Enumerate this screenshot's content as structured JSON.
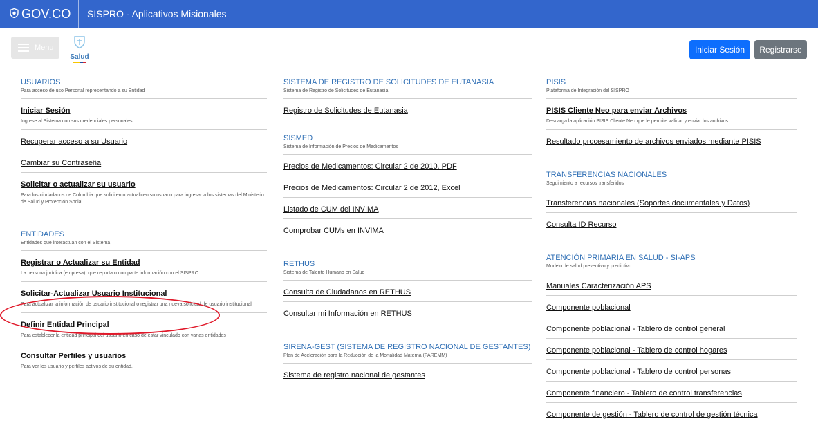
{
  "topbar": {
    "gov_label": "GOV.CO",
    "app_title": "SISPRO - Aplicativos Misionales"
  },
  "header": {
    "menu_label": "Menu",
    "salud_label": "Salud",
    "login_label": "Iniciar Sesión",
    "register_label": "Registrarse"
  },
  "col1": {
    "usuarios": {
      "title": "USUARIOS",
      "subtitle": "Para acceso de uso Personal representando a su Entidad",
      "items": [
        {
          "label": "Iniciar Sesión",
          "desc": "Ingrese al Sistema con sus credenciales personales"
        },
        {
          "label": "Recuperar acceso a su Usuario"
        },
        {
          "label": "Cambiar su Contraseña"
        },
        {
          "label": "Solicitar o actualizar su usuario",
          "desc": "Para los ciudadanos de Colombia que soliciten o actualicen su usuario para ingresar a los sistemas del Ministerio de Salud y Protección Social."
        }
      ]
    },
    "entidades": {
      "title": "ENTIDADES",
      "subtitle": "Entidades que interactuan con el Sistema",
      "items": [
        {
          "label": "Registrar o Actualizar su Entidad",
          "desc": "La persona jurídica (empresa), que reporta o comparte información con el SISPRO"
        },
        {
          "label": "Solicitar-Actualizar Usuario Institucional",
          "desc": "Para actualizar la información de usuario institucional o registrar una nueva solicitud de usuario institucional"
        },
        {
          "label": "Definir Entidad Principal",
          "desc": "Para establecer la entidad principal del usuario en caso de estar vinculado con varias entidades"
        },
        {
          "label": "Consultar Perfiles y usuarios",
          "desc": "Para ver los usuario y perfiles activos de su entidad."
        }
      ]
    }
  },
  "col2": {
    "eutanasia": {
      "title": "SISTEMA DE REGISTRO DE SOLICITUDES DE EUTANASIA",
      "subtitle": "Sistema de Registro de Solicitudes de Eutanasia",
      "items": [
        "Registro de Solicitudes de Eutanasia"
      ]
    },
    "sismed": {
      "title": "SISMED",
      "subtitle": "Sistema de Información de Precios de Medicamentos",
      "items": [
        "Precios de Medicamentos: Circular 2 de 2010, PDF",
        "Precios de Medicamentos: Circular 2 de 2012, Excel",
        "Listado de CUM del INVIMA",
        "Comprobar CUMs en INVIMA"
      ]
    },
    "rethus": {
      "title": "RETHUS",
      "subtitle": "Sistema de Talento Humano en Salud",
      "items": [
        "Consulta de Ciudadanos en RETHUS",
        "Consultar mi Información en RETHUS"
      ]
    },
    "sirena": {
      "title": "SIRENA-GEST (SISTEMA DE REGISTRO NACIONAL DE GESTANTES)",
      "subtitle": "Plan de Aceleración para la Reducción de la Mortalidad Materna (PAREMM)",
      "items": [
        "Sistema de registro nacional de gestantes"
      ]
    }
  },
  "col3": {
    "pisis": {
      "title": "PISIS",
      "subtitle": "Plataforma de Integración del SISPRO",
      "bold_item": {
        "label": "PISIS Cliente Neo para enviar Archivos",
        "desc": "Descarga la aplicación PISIS Cliente Neo que le permite validar y enviar los archivos"
      },
      "items": [
        "Resultado procesamiento de archivos enviados mediante PISIS"
      ]
    },
    "transferencias": {
      "title": "TRANSFERENCIAS NACIONALES",
      "subtitle": "Seguimiento a recursos transferidos",
      "items": [
        "Transferencias nacionales (Soportes documentales y Datos)",
        "Consulta ID Recurso"
      ]
    },
    "aps": {
      "title": "ATENCIÓN PRIMARIA EN SALUD - SI-APS",
      "subtitle": "Modelo de salud preventivo y predictivo",
      "items": [
        "Manuales Caracterización APS",
        "Componente poblacional",
        "Componente poblacional - Tablero de control general",
        "Componente poblacional - Tablero de control hogares",
        "Componente poblacional - Tablero de control personas",
        "Componente financiero - Tablero de control transferencias",
        "Componente de gestión - Tablero de control de gestión técnica"
      ]
    }
  },
  "colors": {
    "topbar": "#3366cc",
    "section_title": "#2f6fb5",
    "primary_button": "#0d6efd",
    "secondary_button": "#6c757d",
    "annotation": "#e0192a"
  }
}
